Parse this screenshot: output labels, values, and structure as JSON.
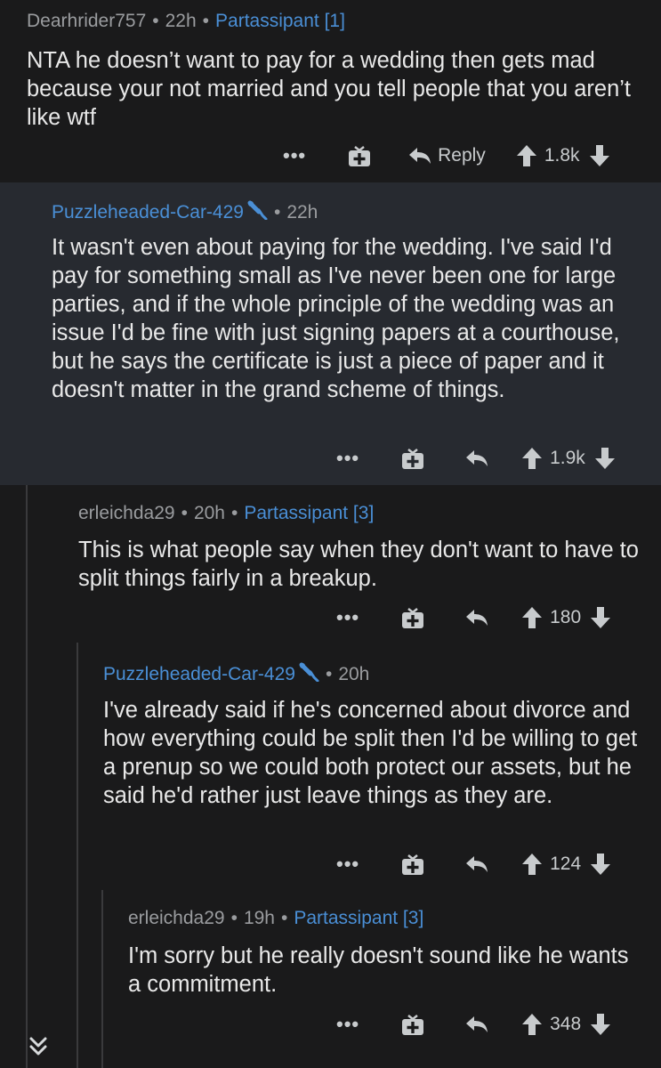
{
  "comments": [
    {
      "author": "Dearhrider757",
      "time": "22h",
      "flair": "Partassipant [1]",
      "body": "NTA he doesn’t want to pay for a wedding then gets mad because your not married and you tell people that you aren’t like wtf",
      "votes": "1.8k",
      "reply_label": "Reply"
    },
    {
      "author": "Puzzleheaded-Car-429",
      "time": "22h",
      "body": "It wasn't even about paying for the wedding. I've said I'd pay for something small as I've never been one for large parties, and if the whole principle of the wedding was an issue I'd be fine with just signing papers at a courthouse, but he says the certificate is just a piece of paper and it doesn't matter in the grand scheme of things.",
      "votes": "1.9k"
    },
    {
      "author": "erleichda29",
      "time": "20h",
      "flair": "Partassipant [3]",
      "body": "This is what people say when they don't want to have to split things fairly in a breakup.",
      "votes": "180"
    },
    {
      "author": "Puzzleheaded-Car-429",
      "time": "20h",
      "body": "I've already said if he's concerned about divorce and how everything could be split then I'd be willing to get a prenup so we could both protect our assets, but he said he'd rather just leave things as they are.",
      "votes": "124"
    },
    {
      "author": "erleichda29",
      "time": "19h",
      "flair": "Partassipant [3]",
      "body": "I'm sorry but he really doesn't sound like he wants a commitment.",
      "votes": "348"
    }
  ],
  "ui": {
    "more_label": "•••",
    "separator": "•"
  },
  "colors": {
    "background": "#1a1a1b",
    "highlight_background": "#272a30",
    "username_op": "#4a8fd6",
    "flair": "#4a8fd6",
    "meta_text": "#9a9c9f",
    "body_text": "#e8e8e8"
  }
}
